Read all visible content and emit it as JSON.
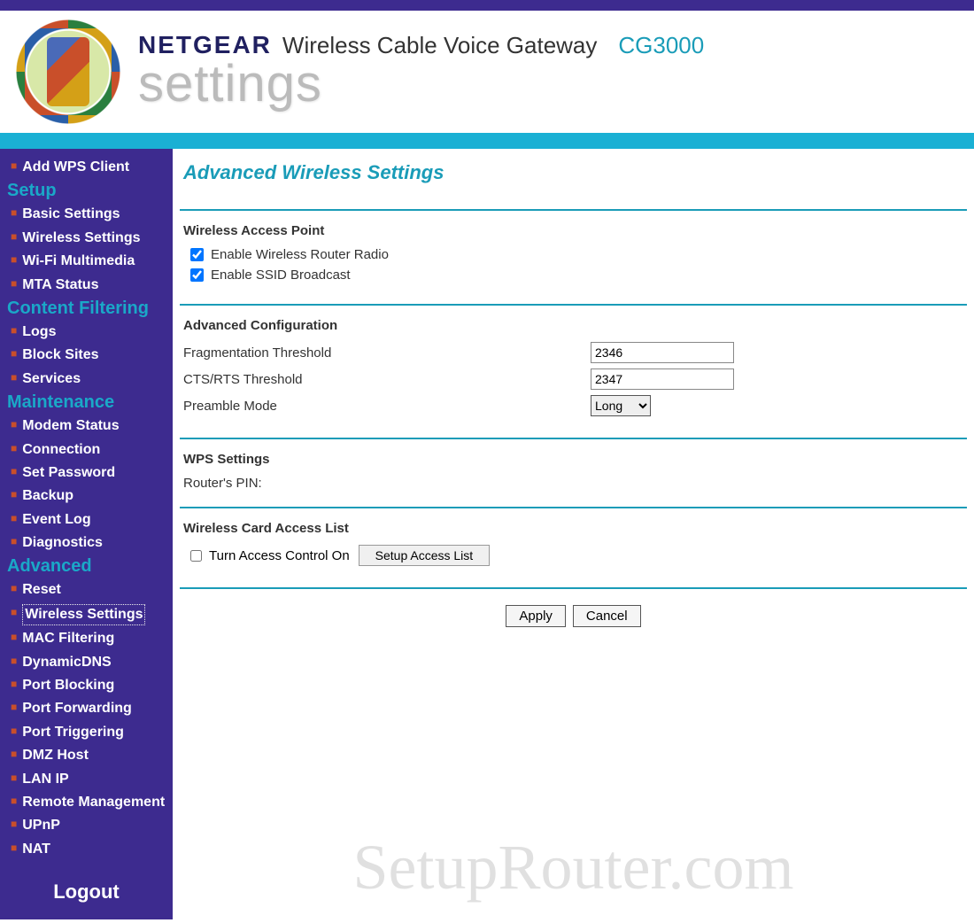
{
  "header": {
    "brand": "NETGEAR",
    "product": "Wireless Cable Voice Gateway",
    "model": "CG3000",
    "settings_word": "settings"
  },
  "sidebar": {
    "top": [
      {
        "label": "Add WPS Client"
      }
    ],
    "groups": [
      {
        "header": "Setup",
        "items": [
          {
            "label": "Basic Settings"
          },
          {
            "label": "Wireless Settings"
          },
          {
            "label": "Wi-Fi Multimedia"
          },
          {
            "label": "MTA Status"
          }
        ]
      },
      {
        "header": "Content Filtering",
        "items": [
          {
            "label": "Logs"
          },
          {
            "label": "Block Sites"
          },
          {
            "label": "Services"
          }
        ]
      },
      {
        "header": "Maintenance",
        "items": [
          {
            "label": "Modem Status"
          },
          {
            "label": "Connection"
          },
          {
            "label": "Set Password"
          },
          {
            "label": "Backup"
          },
          {
            "label": "Event Log"
          },
          {
            "label": "Diagnostics"
          }
        ]
      },
      {
        "header": "Advanced",
        "items": [
          {
            "label": "Reset"
          },
          {
            "label": "Wireless Settings",
            "active": true
          },
          {
            "label": "MAC Filtering"
          },
          {
            "label": "DynamicDNS"
          },
          {
            "label": "Port Blocking"
          },
          {
            "label": "Port Forwarding"
          },
          {
            "label": "Port Triggering"
          },
          {
            "label": "DMZ Host"
          },
          {
            "label": "LAN IP"
          },
          {
            "label": "Remote Management"
          },
          {
            "label": "UPnP"
          },
          {
            "label": "NAT"
          }
        ]
      }
    ],
    "logout": "Logout"
  },
  "page": {
    "title": "Advanced Wireless Settings",
    "wap": {
      "heading": "Wireless Access Point",
      "enable_radio_label": "Enable Wireless Router Radio",
      "enable_radio_checked": true,
      "enable_ssid_label": "Enable SSID Broadcast",
      "enable_ssid_checked": true
    },
    "adv": {
      "heading": "Advanced Configuration",
      "frag_label": "Fragmentation Threshold",
      "frag_value": "2346",
      "cts_label": "CTS/RTS Threshold",
      "cts_value": "2347",
      "preamble_label": "Preamble Mode",
      "preamble_value": "Long"
    },
    "wps": {
      "heading": "WPS Settings",
      "pin_label": "Router's PIN:"
    },
    "acl": {
      "heading": "Wireless Card Access List",
      "turn_on_label": "Turn Access Control On",
      "turn_on_checked": false,
      "setup_button": "Setup Access List"
    },
    "apply_label": "Apply",
    "cancel_label": "Cancel"
  },
  "watermark": "SetupRouter.com"
}
